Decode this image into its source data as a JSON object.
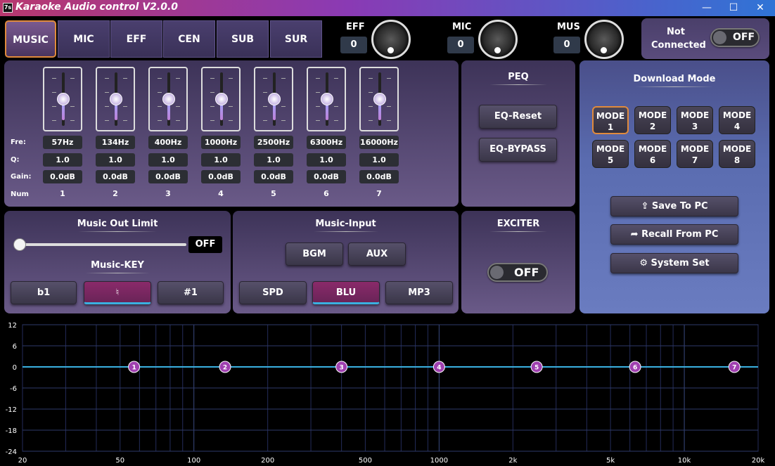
{
  "window": {
    "title": "Karaoke Audio control V2.0.0",
    "icon_label": "7s",
    "minimize": "—",
    "maximize": "☐",
    "close": "✕"
  },
  "tabs": [
    {
      "label": "MUSIC",
      "active": true
    },
    {
      "label": "MIC",
      "active": false
    },
    {
      "label": "EFF",
      "active": false
    },
    {
      "label": "CEN",
      "active": false
    },
    {
      "label": "SUB",
      "active": false
    },
    {
      "label": "SUR",
      "active": false
    }
  ],
  "volumes": [
    {
      "label": "EFF",
      "value": "0"
    },
    {
      "label": "MIC",
      "value": "0"
    },
    {
      "label": "MUS",
      "value": "0"
    }
  ],
  "connection": {
    "status": "Not Connected",
    "status_line1": "Not",
    "status_line2": "Connected",
    "toggle": "OFF"
  },
  "peq": {
    "row_labels": {
      "fre": "Fre:",
      "q": "Q:",
      "gain": "Gain:",
      "num": "Num"
    },
    "bands": [
      {
        "fre": "57Hz",
        "q": "1.0",
        "gain": "0.0dB",
        "num": "1"
      },
      {
        "fre": "134Hz",
        "q": "1.0",
        "gain": "0.0dB",
        "num": "2"
      },
      {
        "fre": "400Hz",
        "q": "1.0",
        "gain": "0.0dB",
        "num": "3"
      },
      {
        "fre": "1000Hz",
        "q": "1.0",
        "gain": "0.0dB",
        "num": "4"
      },
      {
        "fre": "2500Hz",
        "q": "1.0",
        "gain": "0.0dB",
        "num": "5"
      },
      {
        "fre": "6300Hz",
        "q": "1.0",
        "gain": "0.0dB",
        "num": "6"
      },
      {
        "fre": "16000Hz",
        "q": "1.0",
        "gain": "0.0dB",
        "num": "7"
      }
    ],
    "title": "PEQ",
    "reset_label": "EQ-Reset",
    "bypass_label": "EQ-BYPASS"
  },
  "download": {
    "title": "Download Mode",
    "modes": [
      {
        "l1": "MODE",
        "l2": "1",
        "active": true
      },
      {
        "l1": "MODE",
        "l2": "2",
        "active": false
      },
      {
        "l1": "MODE",
        "l2": "3",
        "active": false
      },
      {
        "l1": "MODE",
        "l2": "4",
        "active": false
      },
      {
        "l1": "MODE",
        "l2": "5",
        "active": false
      },
      {
        "l1": "MODE",
        "l2": "6",
        "active": false
      },
      {
        "l1": "MODE",
        "l2": "7",
        "active": false
      },
      {
        "l1": "MODE",
        "l2": "8",
        "active": false
      }
    ],
    "save_label": "Save To PC",
    "recall_label": "Recall From PC",
    "system_label": "System Set"
  },
  "out_limit": {
    "title": "Music Out Limit",
    "toggle": "OFF",
    "slider_level": 0
  },
  "key": {
    "title": "Music-KEY",
    "buttons": [
      {
        "label": "b1",
        "active": false
      },
      {
        "label": "♮",
        "active": true
      },
      {
        "label": "#1",
        "active": false
      }
    ]
  },
  "input": {
    "title": "Music-Input",
    "row1": [
      {
        "label": "BGM",
        "active": false
      },
      {
        "label": "AUX",
        "active": false
      }
    ],
    "row2": [
      {
        "label": "SPD",
        "active": false
      },
      {
        "label": "BLU",
        "active": true
      },
      {
        "label": "MP3",
        "active": false
      }
    ]
  },
  "exciter": {
    "title": "EXCITER",
    "toggle": "OFF"
  },
  "graph": {
    "y_ticks": [
      "12",
      "6",
      "0",
      "-6",
      "-12",
      "-18",
      "-24"
    ],
    "x_ticks": [
      "20",
      "50",
      "100",
      "200",
      "500",
      "1000",
      "2k",
      "5k",
      "10k",
      "20k"
    ],
    "points": [
      "1",
      "2",
      "3",
      "4",
      "5",
      "6",
      "7"
    ]
  },
  "colors": {
    "accent_orange": "#e08a3c",
    "curve": "#3ab0e0",
    "grid": "#2e3a6a"
  }
}
